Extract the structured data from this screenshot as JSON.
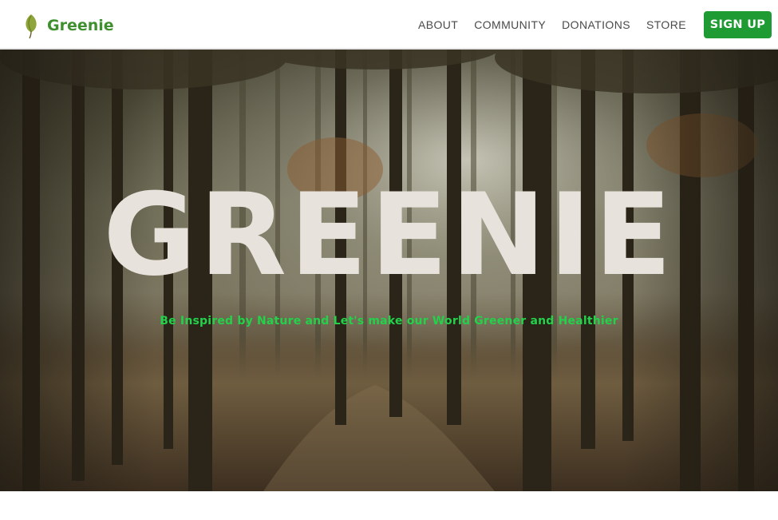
{
  "brand": {
    "name": "Greenie",
    "icon": "leaf-icon",
    "color": "#3f8f2e"
  },
  "nav": {
    "items": [
      "ABOUT",
      "COMMUNITY",
      "DONATIONS",
      "STORE"
    ],
    "signup_label": "SIGN UP",
    "signup_color": "#1e9b32"
  },
  "hero": {
    "title": "GREENIE",
    "tagline": "Be Inspired by Nature and Let's make our World Greener and Healthier",
    "title_color": "#e7e3dc",
    "tagline_color": "#23d14a",
    "background": "forest-photo"
  }
}
